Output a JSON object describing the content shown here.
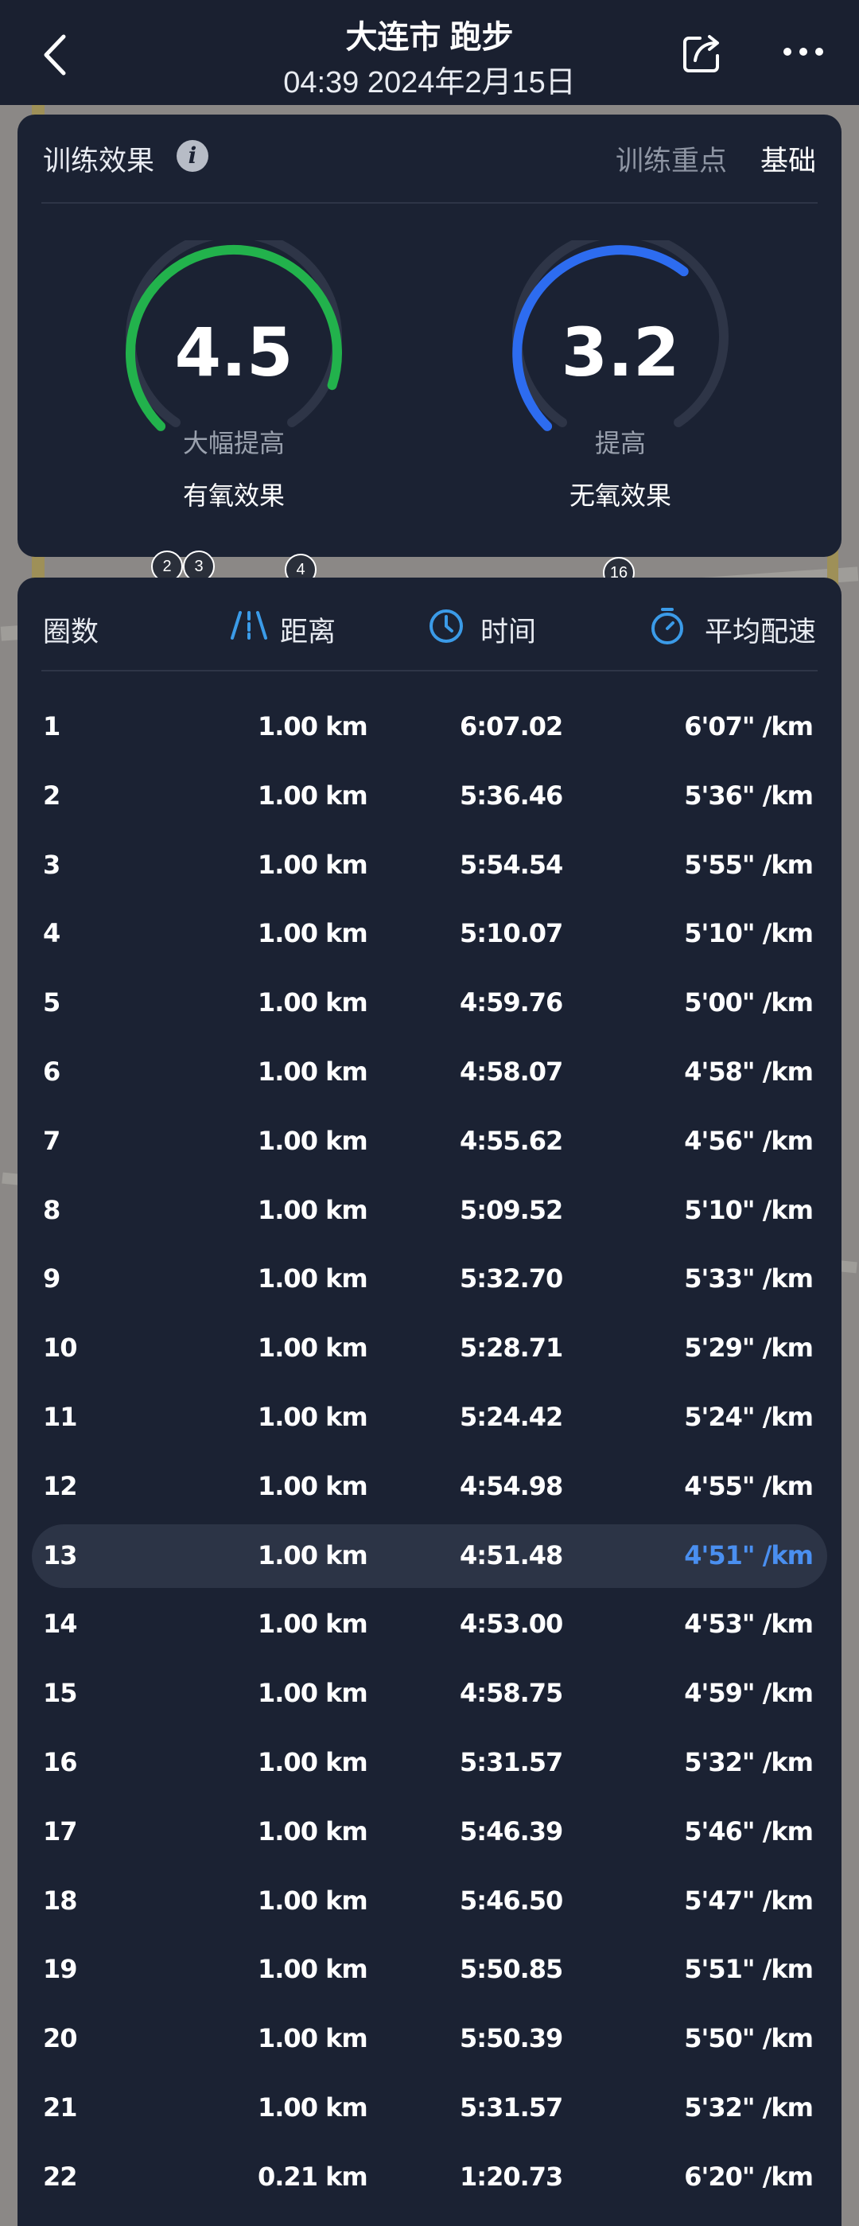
{
  "header": {
    "title": "大连市 跑步",
    "subtitle": "04:39 2024年2月15日"
  },
  "effect": {
    "label": "训练效果",
    "focus_label": "训练重点",
    "focus_value": "基础",
    "aerobic": {
      "value": "4.5",
      "desc": "大幅提高",
      "name": "有氧效果",
      "color": "#22b24c",
      "level": 0.9
    },
    "anaerobic": {
      "value": "3.2",
      "desc": "提高",
      "name": "无氧效果",
      "color": "#2d6cf0",
      "level": 0.64
    }
  },
  "map_markers": [
    "2",
    "3",
    "4",
    "16"
  ],
  "laps": {
    "headers": {
      "lap": "圈数",
      "distance": "距离",
      "time": "时间",
      "pace": "平均配速"
    },
    "highlight_color": "#4a8ff0",
    "highlighted_lap": "13",
    "rows": [
      {
        "lap": "1",
        "distance": "1.00 km",
        "time": "6:07.02",
        "pace": "6'07\" /km"
      },
      {
        "lap": "2",
        "distance": "1.00 km",
        "time": "5:36.46",
        "pace": "5'36\" /km"
      },
      {
        "lap": "3",
        "distance": "1.00 km",
        "time": "5:54.54",
        "pace": "5'55\" /km"
      },
      {
        "lap": "4",
        "distance": "1.00 km",
        "time": "5:10.07",
        "pace": "5'10\" /km"
      },
      {
        "lap": "5",
        "distance": "1.00 km",
        "time": "4:59.76",
        "pace": "5'00\" /km"
      },
      {
        "lap": "6",
        "distance": "1.00 km",
        "time": "4:58.07",
        "pace": "4'58\" /km"
      },
      {
        "lap": "7",
        "distance": "1.00 km",
        "time": "4:55.62",
        "pace": "4'56\" /km"
      },
      {
        "lap": "8",
        "distance": "1.00 km",
        "time": "5:09.52",
        "pace": "5'10\" /km"
      },
      {
        "lap": "9",
        "distance": "1.00 km",
        "time": "5:32.70",
        "pace": "5'33\" /km"
      },
      {
        "lap": "10",
        "distance": "1.00 km",
        "time": "5:28.71",
        "pace": "5'29\" /km"
      },
      {
        "lap": "11",
        "distance": "1.00 km",
        "time": "5:24.42",
        "pace": "5'24\" /km"
      },
      {
        "lap": "12",
        "distance": "1.00 km",
        "time": "4:54.98",
        "pace": "4'55\" /km"
      },
      {
        "lap": "13",
        "distance": "1.00 km",
        "time": "4:51.48",
        "pace": "4'51\" /km"
      },
      {
        "lap": "14",
        "distance": "1.00 km",
        "time": "4:53.00",
        "pace": "4'53\" /km"
      },
      {
        "lap": "15",
        "distance": "1.00 km",
        "time": "4:58.75",
        "pace": "4'59\" /km"
      },
      {
        "lap": "16",
        "distance": "1.00 km",
        "time": "5:31.57",
        "pace": "5'32\" /km"
      },
      {
        "lap": "17",
        "distance": "1.00 km",
        "time": "5:46.39",
        "pace": "5'46\" /km"
      },
      {
        "lap": "18",
        "distance": "1.00 km",
        "time": "5:46.50",
        "pace": "5'47\" /km"
      },
      {
        "lap": "19",
        "distance": "1.00 km",
        "time": "5:50.85",
        "pace": "5'51\" /km"
      },
      {
        "lap": "20",
        "distance": "1.00 km",
        "time": "5:50.39",
        "pace": "5'50\" /km"
      },
      {
        "lap": "21",
        "distance": "1.00 km",
        "time": "5:31.57",
        "pace": "5'32\" /km"
      },
      {
        "lap": "22",
        "distance": "0.21 km",
        "time": "1:20.73",
        "pace": "6'20\" /km"
      }
    ]
  }
}
